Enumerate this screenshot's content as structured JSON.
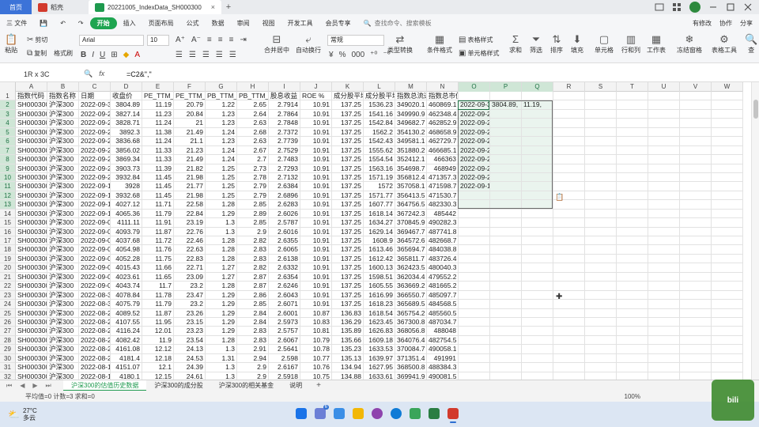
{
  "tabbar": {
    "home": "首页",
    "draft": "稻壳",
    "file_tab": "20221005_IndexData_SH000300",
    "plus": "+",
    "close": "×"
  },
  "menubar": {
    "file": "三 文件",
    "items": [
      "开始",
      "插入",
      "页面布局",
      "公式",
      "数据",
      "审阅",
      "视图",
      "开发工具",
      "会员专享"
    ],
    "search": "查找命令、搜索模板",
    "right": [
      "有修改",
      "协作",
      "分享"
    ]
  },
  "ribbon": {
    "paste": "粘贴",
    "cut": "剪切",
    "copy": "复制",
    "format_painter": "格式刷",
    "font": "Arial",
    "font_size": "10",
    "merge": "合并居中",
    "wrap": "自动换行",
    "number_format": "常规",
    "type_convert": "类型转换",
    "cond_format": "条件格式",
    "table_style": "表格样式",
    "cell_style": "单元格样式",
    "sum": "求和",
    "filter": "筛选",
    "sort": "排序",
    "fill": "填充",
    "cell": "单元格",
    "row_col": "行和列",
    "worksheet": "工作表",
    "freeze": "冻结窗格",
    "table_tools": "表格工具",
    "find": "查"
  },
  "formula_bar": {
    "name_box": "1R x 3C",
    "fx": "fx",
    "formula": "=C2&\",\""
  },
  "columns": [
    "A",
    "B",
    "C",
    "D",
    "E",
    "F",
    "G",
    "H",
    "I",
    "J",
    "K",
    "L",
    "M",
    "N",
    "O",
    "P",
    "Q",
    "R",
    "S",
    "T",
    "U",
    "V",
    "W"
  ],
  "rows": [
    [
      "指数代码",
      "指数名称",
      "日期",
      "收盘价",
      "PE_TTM_",
      "PE_TTM_",
      "PB_TTM_",
      "PB_TTM_",
      "股息收益",
      "ROE %",
      "成分股平均",
      "成分股平均",
      "指数总流通",
      "指数总市值(亿)",
      "",
      "",
      ""
    ],
    [
      "SH000300",
      "沪深300",
      "2022-09-3",
      "3804.89",
      "11.19",
      "20.79",
      "1.22",
      "2.65",
      "2.7914",
      "10.91",
      "137.25",
      "1536.23",
      "349020.1",
      "460869.1",
      "2022-09-3,",
      "3804.89,",
      "11.19,"
    ],
    [
      "SH000300",
      "沪深300",
      "2022-09-2",
      "3827.14",
      "11.23",
      "20.84",
      "1.23",
      "2.64",
      "2.7864",
      "10.91",
      "137.25",
      "1541.16",
      "349990.9",
      "462348.4",
      "2022-09-29,",
      "",
      ""
    ],
    [
      "SH000300",
      "沪深300",
      "2022-09-2",
      "3828.71",
      "11.24",
      "21",
      "1.23",
      "2.63",
      "2.7848",
      "10.91",
      "137.25",
      "1542.84",
      "349682.7",
      "462852.9",
      "2022-09-28,",
      "",
      ""
    ],
    [
      "SH000300",
      "沪深300",
      "2022-09-2",
      "3892.3",
      "11.38",
      "21.49",
      "1.24",
      "2.68",
      "2.7372",
      "10.91",
      "137.25",
      "1562.2",
      "354130.2",
      "468658.9",
      "2022-09-27,",
      "",
      ""
    ],
    [
      "SH000300",
      "沪深300",
      "2022-09-2",
      "3836.68",
      "11.24",
      "21.1",
      "1.23",
      "2.63",
      "2.7739",
      "10.91",
      "137.25",
      "1542.43",
      "349581.1",
      "462729.7",
      "2022-09-26,",
      "",
      ""
    ],
    [
      "SH000300",
      "沪深300",
      "2022-09-2",
      "3856.02",
      "11.33",
      "21.23",
      "1.24",
      "2.67",
      "2.7529",
      "10.91",
      "137.25",
      "1555.62",
      "351880.2",
      "466685.1",
      "2022-09-23,",
      "",
      ""
    ],
    [
      "SH000300",
      "沪深300",
      "2022-09-2",
      "3869.34",
      "11.33",
      "21.49",
      "1.24",
      "2.7",
      "2.7483",
      "10.91",
      "137.25",
      "1554.54",
      "352412.1",
      "466363",
      "2022-09-22,",
      "",
      ""
    ],
    [
      "SH000300",
      "沪深300",
      "2022-09-2",
      "3903.73",
      "11.39",
      "21.82",
      "1.25",
      "2.73",
      "2.7293",
      "10.91",
      "137.25",
      "1563.16",
      "354698.7",
      "468949",
      "2022-09-21,",
      "",
      ""
    ],
    [
      "SH000300",
      "沪深300",
      "2022-09-2",
      "3932.84",
      "11.45",
      "21.98",
      "1.25",
      "2.78",
      "2.7132",
      "10.91",
      "137.25",
      "1571.19",
      "356812.4",
      "471357.3",
      "2022-09-20,",
      "",
      ""
    ],
    [
      "SH000300",
      "沪深300",
      "2022-09-1",
      "3928",
      "11.45",
      "21.77",
      "1.25",
      "2.79",
      "2.6384",
      "10.91",
      "137.25",
      "1572",
      "357058.1",
      "471598.7",
      "2022-09-19,",
      "",
      ""
    ],
    [
      "SH000300",
      "沪深300",
      "2022-09-1",
      "3932.68",
      "11.45",
      "21.98",
      "1.25",
      "2.79",
      "2.6896",
      "10.91",
      "137.25",
      "1571.77",
      "356413.5",
      "471530.7",
      "",
      "",
      ""
    ],
    [
      "SH000300",
      "沪深300",
      "2022-09-1",
      "4027.12",
      "11.71",
      "22.58",
      "1.28",
      "2.85",
      "2.6283",
      "10.91",
      "137.25",
      "1607.77",
      "364756.5",
      "482330.3",
      "",
      "",
      ""
    ],
    [
      "SH000300",
      "沪深300",
      "2022-09-1",
      "4065.36",
      "11.79",
      "22.84",
      "1.29",
      "2.89",
      "2.6026",
      "10.91",
      "137.25",
      "1618.14",
      "367242.3",
      "485442",
      "",
      "",
      ""
    ],
    [
      "SH000300",
      "沪深300",
      "2022-09-0",
      "4111.11",
      "11.91",
      "23.19",
      "1.3",
      "2.85",
      "2.5787",
      "10.91",
      "137.25",
      "1634.27",
      "370845.9",
      "490282.3",
      "",
      "",
      ""
    ],
    [
      "SH000300",
      "沪深300",
      "2022-09-0",
      "4093.79",
      "11.87",
      "22.76",
      "1.3",
      "2.9",
      "2.6016",
      "10.91",
      "137.25",
      "1629.14",
      "369467.7",
      "487741.8",
      "",
      "",
      ""
    ],
    [
      "SH000300",
      "沪深300",
      "2022-09-0",
      "4037.68",
      "11.72",
      "22.46",
      "1.28",
      "2.82",
      "2.6355",
      "10.91",
      "137.25",
      "1608.9",
      "364572.6",
      "482668.7",
      "",
      "",
      ""
    ],
    [
      "SH000300",
      "沪深300",
      "2022-09-0",
      "4054.98",
      "11.76",
      "22.63",
      "1.28",
      "2.83",
      "2.6065",
      "10.91",
      "137.25",
      "1613.46",
      "365694.7",
      "484038.8",
      "",
      "",
      ""
    ],
    [
      "SH000300",
      "沪深300",
      "2022-09-0",
      "4052.28",
      "11.75",
      "22.83",
      "1.28",
      "2.83",
      "2.6138",
      "10.91",
      "137.25",
      "1612.42",
      "365811.7",
      "483726.4",
      "",
      "",
      ""
    ],
    [
      "SH000300",
      "沪深300",
      "2022-09-0",
      "4015.43",
      "11.66",
      "22.71",
      "1.27",
      "2.82",
      "2.6332",
      "10.91",
      "137.25",
      "1600.13",
      "362423.5",
      "480040.3",
      "",
      "",
      ""
    ],
    [
      "SH000300",
      "沪深300",
      "2022-09-0",
      "4023.61",
      "11.65",
      "23.09",
      "1.27",
      "2.87",
      "2.6354",
      "10.91",
      "137.25",
      "1598.51",
      "362034.4",
      "479552.2",
      "",
      "",
      ""
    ],
    [
      "SH000300",
      "沪深300",
      "2022-09-0",
      "4043.74",
      "11.7",
      "23.2",
      "1.28",
      "2.87",
      "2.6246",
      "10.91",
      "137.25",
      "1605.55",
      "363669.2",
      "481665.2",
      "",
      "",
      ""
    ],
    [
      "SH000300",
      "沪深300",
      "2022-08-3",
      "4078.84",
      "11.78",
      "23.47",
      "1.29",
      "2.86",
      "2.6043",
      "10.91",
      "137.25",
      "1616.99",
      "366550.7",
      "485097.7",
      "",
      "",
      ""
    ],
    [
      "SH000300",
      "沪深300",
      "2022-08-3",
      "4075.79",
      "11.79",
      "23.2",
      "1.29",
      "2.85",
      "2.6071",
      "10.91",
      "137.25",
      "1618.23",
      "365689.5",
      "484568.5",
      "",
      "",
      ""
    ],
    [
      "SH000300",
      "沪深300",
      "2022-08-2",
      "4089.52",
      "11.87",
      "23.26",
      "1.29",
      "2.84",
      "2.6001",
      "10.87",
      "136.83",
      "1618.54",
      "365754.2",
      "485560.5",
      "",
      "",
      ""
    ],
    [
      "SH000300",
      "沪深300",
      "2022-08-2",
      "4107.55",
      "11.95",
      "23.15",
      "1.29",
      "2.84",
      "2.5973",
      "10.83",
      "136.29",
      "1623.45",
      "367300.8",
      "487034.7",
      "",
      "",
      ""
    ],
    [
      "SH000300",
      "沪深300",
      "2022-08-2",
      "4116.24",
      "12.01",
      "23.23",
      "1.29",
      "2.83",
      "2.5757",
      "10.81",
      "135.89",
      "1626.83",
      "368056.8",
      "488048",
      "",
      "",
      ""
    ],
    [
      "SH000300",
      "沪深300",
      "2022-08-2",
      "4082.42",
      "11.9",
      "23.54",
      "1.28",
      "2.83",
      "2.6067",
      "10.79",
      "135.66",
      "1609.18",
      "364076.4",
      "482754.5",
      "",
      "",
      ""
    ],
    [
      "SH000300",
      "沪深300",
      "2022-08-2",
      "4161.08",
      "12.12",
      "24.13",
      "1.3",
      "2.91",
      "2.5641",
      "10.78",
      "135.23",
      "1633.53",
      "370084.7",
      "490058.1",
      "",
      "",
      ""
    ],
    [
      "SH000300",
      "沪深300",
      "2022-08-2",
      "4181.4",
      "12.18",
      "24.53",
      "1.31",
      "2.94",
      "2.598",
      "10.77",
      "135.13",
      "1639.97",
      "371351.4",
      "491991",
      "",
      "",
      ""
    ],
    [
      "SH000300",
      "沪深300",
      "2022-08-1",
      "4151.07",
      "12.1",
      "24.39",
      "1.3",
      "2.9",
      "2.6167",
      "10.76",
      "134.94",
      "1627.95",
      "368500.8",
      "488384.3",
      "",
      "",
      ""
    ],
    [
      "SH000300",
      "沪深300",
      "2022-08-1",
      "4180.1",
      "12.15",
      "24.61",
      "1.3",
      "2.9",
      "2.5918",
      "10.75",
      "134.88",
      "1633.61",
      "369941.9",
      "490081.5",
      "",
      "",
      ""
    ],
    [
      "SH000300",
      "沪深300",
      "2022-08-1",
      "4216.96",
      "12.27",
      "25.08",
      "1.31",
      "2.94",
      "2.5676",
      "10.74",
      "134.69",
      "1647.52",
      "373415",
      "494255.7",
      "",
      "",
      ""
    ]
  ],
  "sheets": [
    "沪深300的估值历史数据",
    "沪深300的成分股",
    "沪深300的相关基金",
    "说明"
  ],
  "status": {
    "stats": "平均值=0  计数=3  求和=0",
    "zoom": "100%"
  },
  "taskbar": {
    "temp": "27°C",
    "weather": "多云"
  },
  "paste_tag": "📋",
  "badge_count": "6",
  "watermark": "bili"
}
